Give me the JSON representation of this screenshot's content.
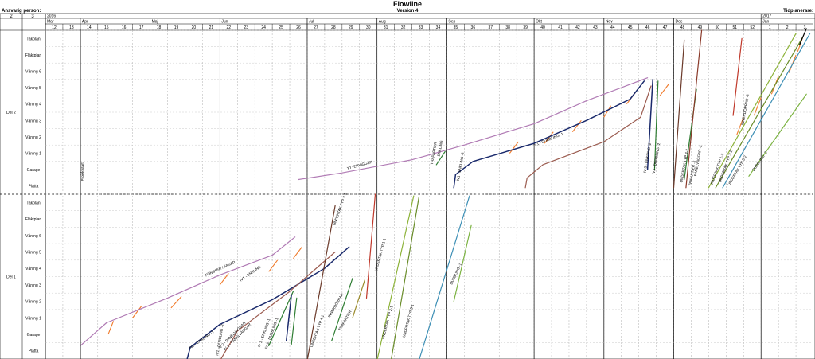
{
  "header": {
    "title": "Flowline",
    "version": "Version 4",
    "responsible_label": "Ansvarig person:",
    "planner_label": "Tidplanerare:",
    "col1_number": "2",
    "col2_number": "3"
  },
  "chart_data": {
    "type": "line",
    "title": "Flowline",
    "subtitle": "Version 4",
    "x_axis": {
      "unit": "week",
      "years": [
        {
          "label": "2016",
          "week": 12
        },
        {
          "label": "2017",
          "week": 53
        }
      ],
      "months": [
        {
          "label": "Mar",
          "week": 12
        },
        {
          "label": "Apr",
          "week": 14
        },
        {
          "label": "Maj",
          "week": 18
        },
        {
          "label": "Jun",
          "week": 22
        },
        {
          "label": "Jul",
          "week": 27
        },
        {
          "label": "Aug",
          "week": 31
        },
        {
          "label": "Sep",
          "week": 35
        },
        {
          "label": "Okt",
          "week": 40
        },
        {
          "label": "Nov",
          "week": 44
        },
        {
          "label": "Dec",
          "week": 48
        },
        {
          "label": "Jan",
          "week": 53
        }
      ],
      "weeks": [
        "12",
        "13",
        "14",
        "15",
        "16",
        "17",
        "18",
        "19",
        "20",
        "21",
        "22",
        "23",
        "24",
        "25",
        "26",
        "27",
        "28",
        "29",
        "30",
        "31",
        "32",
        "33",
        "34",
        "35",
        "36",
        "37",
        "38",
        "39",
        "40",
        "41",
        "42",
        "43",
        "44",
        "45",
        "46",
        "47",
        "48",
        "49",
        "50",
        "51",
        "52",
        "1",
        "2",
        "3"
      ],
      "range": [
        12,
        56
      ]
    },
    "y_axis": {
      "levels": [
        "Platta",
        "Garage",
        "Våning 1",
        "Våning 2",
        "Våning 3",
        "Våning 4",
        "Våning 5",
        "Våning 6",
        "Fläktplan",
        "Takplan"
      ]
    },
    "sections": [
      {
        "name": "Del 2",
        "series": [
          {
            "label": "YTTERVIGGAR",
            "color": "#b07ab4",
            "points": [
              [
                26.5,
                0.4
              ],
              [
                29,
                0.8
              ],
              [
                33,
                1.6
              ],
              [
                36,
                2.5
              ],
              [
                40,
                3.8
              ],
              [
                43,
                5.2
              ],
              [
                46.5,
                6.6
              ]
            ]
          },
          {
            "label": "IV1 - ENKLING -2",
            "color": "#1a2a6c",
            "points": [
              [
                35.4,
                -0.1
              ],
              [
                35.5,
                0.7
              ],
              [
                36.5,
                1.5
              ],
              [
                40,
                2.6
              ],
              [
                43,
                4.0
              ],
              [
                45.5,
                5.3
              ],
              [
                46.3,
                6.4
              ]
            ]
          },
          {
            "label": "IV1 - DUBBLING -1",
            "color": "#9a5a4e",
            "points": [
              [
                39.5,
                -0.1
              ],
              [
                39.6,
                0.5
              ],
              [
                40.5,
                1.3
              ],
              [
                44,
                2.7
              ],
              [
                46.1,
                4.2
              ],
              [
                46.7,
                6.1
              ]
            ]
          },
          {
            "label": "IV3 - ENKLING -2",
            "color": "#1a2a6c",
            "points": [
              [
                46.5,
                1.0
              ],
              [
                46.8,
                6.5
              ]
            ]
          },
          {
            "label": "IV3 - DUBBLING -2",
            "color": "#2e7d32",
            "points": [
              [
                46.9,
                1.0
              ],
              [
                47.1,
                6.4
              ]
            ]
          },
          {
            "label": "TRIPARTIER -2",
            "color": "#6b3a2a",
            "points": [
              [
                48.0,
                -0.1
              ],
              [
                48.6,
                8.9
              ]
            ]
          },
          {
            "label": "PANELVÄGGAR -2",
            "color": "#2e7d32",
            "points": [
              [
                48.6,
                0.4
              ],
              [
                49.3,
                5.9
              ]
            ]
          },
          {
            "label": "UNDERTAK TYP 4-2",
            "color": "#8a3a2a",
            "points": [
              [
                48.7,
                -0.1
              ],
              [
                49.6,
                9.5
              ]
            ]
          },
          {
            "label": "INNERDÖRRAR -2",
            "color": "#c0392b",
            "points": [
              [
                51.4,
                4.3
              ],
              [
                51.9,
                9.0
              ]
            ]
          },
          {
            "label": "UNDERTAK TYP 1-2",
            "color": "#8db33a",
            "points": [
              [
                50.0,
                -0.1
              ],
              [
                55.0,
                9.3
              ]
            ]
          },
          {
            "label": "UNDERTAK TYP 3-2",
            "color": "#6a8d2a",
            "points": [
              [
                50.4,
                -0.1
              ],
              [
                55.4,
                9.1
              ]
            ]
          },
          {
            "label": "UNDERTAK TYP 5-2",
            "color": "#3d8fb5",
            "points": [
              [
                50.8,
                -0.1
              ],
              [
                55.8,
                9.3
              ]
            ]
          },
          {
            "label": "DUBBLING -2",
            "color": "#7cb342",
            "points": [
              [
                52.3,
                0.6
              ],
              [
                55.6,
                5.6
              ]
            ]
          },
          {
            "label": "TRÄPARTIER",
            "color": "#2e7d32",
            "points": [
              [
                34.4,
                1.3
              ],
              [
                34.9,
                2.1
              ]
            ]
          },
          {
            "label": "HISSTRAPP",
            "color": "#000000",
            "points": [
              [
                55.2,
                8.6
              ],
              [
                55.6,
                9.6
              ]
            ]
          }
        ]
      },
      {
        "name": "Del 1",
        "series": [
          {
            "label": "FÖNSTER / FASAD",
            "color": "#b07ab4",
            "points": [
              [
                14.0,
                0.3
              ],
              [
                15.5,
                1.7
              ],
              [
                19,
                3.2
              ],
              [
                22,
                4.6
              ],
              [
                25,
                5.8
              ],
              [
                26.3,
                6.9
              ]
            ]
          },
          {
            "label": "IV1 - ENKLING -1",
            "color": "#1a2a6c",
            "points": [
              [
                20.1,
                -0.6
              ],
              [
                20.3,
                0.2
              ],
              [
                22,
                1.6
              ],
              [
                25,
                3.1
              ],
              [
                28,
                5.0
              ],
              [
                29.4,
                6.3
              ]
            ]
          },
          {
            "label": "IV1 - DUBBLING -2",
            "color": "#9a5a4e",
            "points": [
              [
                22.0,
                -0.6
              ],
              [
                23,
                1.2
              ],
              [
                26,
                3.6
              ],
              [
                28.6,
                6.0
              ]
            ]
          },
          {
            "label": "IV 2 - PANELVÄGGAR",
            "color": "#2e7d32",
            "points": [
              [
                24.8,
                0.3
              ],
              [
                26.2,
                3.6
              ]
            ]
          },
          {
            "label": "IV 3 - ENKLING -1",
            "color": "#1a2a6c",
            "points": [
              [
                25.8,
                0.6
              ],
              [
                26.1,
                3.4
              ]
            ]
          },
          {
            "label": "IV 3 - DUBBLING -1",
            "color": "#2e7d32",
            "points": [
              [
                26.1,
                0.4
              ],
              [
                26.4,
                3.2
              ]
            ]
          },
          {
            "label": "UNDERTAK TYP 4-1",
            "color": "#6b3a2a",
            "points": [
              [
                27.0,
                -0.6
              ],
              [
                28.6,
                8.8
              ]
            ]
          },
          {
            "label": "TRÄPARTIER",
            "color": "#2e7d32",
            "points": [
              [
                28.4,
                0.6
              ],
              [
                29.6,
                4.4
              ]
            ]
          },
          {
            "label": "INNERDÖRRAR",
            "color": "#9a8a2a",
            "points": [
              [
                29.6,
                2.0
              ],
              [
                30.3,
                4.3
              ]
            ]
          },
          {
            "label": "UNDERTAK TYP 1-1",
            "color": "#8db33a",
            "points": [
              [
                31.0,
                -0.6
              ],
              [
                33.1,
                9.4
              ]
            ]
          },
          {
            "label": "UNDERTAK TYP 2-1",
            "color": "#6a8d2a",
            "points": [
              [
                31.8,
                -0.6
              ],
              [
                33.4,
                9.3
              ]
            ]
          },
          {
            "label": "UNDERTAK TYP 5-1",
            "color": "#3d8fb5",
            "points": [
              [
                33.4,
                -0.6
              ],
              [
                36.3,
                9.4
              ]
            ]
          },
          {
            "label": "UNDERTAK TYP 3-1",
            "color": "#c0392b",
            "points": [
              [
                30.4,
                3.2
              ],
              [
                30.9,
                9.5
              ]
            ]
          },
          {
            "label": "DUBBLING -1",
            "color": "#7cb342",
            "points": [
              [
                35.4,
                3.0
              ],
              [
                36.4,
                7.6
              ]
            ]
          },
          {
            "label": "Projektstart",
            "color": "#000000",
            "points": [
              [
                14.0,
                -0.6
              ],
              [
                14.0,
                19.5
              ]
            ]
          }
        ]
      }
    ],
    "annotations": {
      "del2": [
        "YTTERVIGGAR",
        "TRÄPARTIER",
        "ENKLING",
        "IV1 - ENKLING -2",
        "IV1 - DUBBLING -1",
        "IV 3 - ENKLING -2",
        "IV3 - DUBBLING -2",
        "UNDERTAK TYP 4-2",
        "TRIPARTIER -2",
        "PANELVÄGGAR -2",
        "INNERDÖRRAR -2",
        "UNDERTAK TYP 1-2",
        "UNDERTAK TYP 3-2",
        "UNDERTAK TYP 5-2",
        "DUBBLING -2"
      ],
      "del1": [
        "FÖNSTER / FASAD",
        "IV1 - ENKLING -1",
        "IV1 - ENKLING",
        "IV1 - DUBBLING -2",
        "IV 2 - PANELVÄGGAR",
        "IV 2 - PANELVÄGGAR",
        "IV 3 - ENKLING -1",
        "IV 3 - DUBBLING -1",
        "UNDERTAK TYP 4-1",
        "TRÄPARTIER",
        "INNERDÖRRAR",
        "UNDERTAK TYP 1-1",
        "UNDERTAK TYP 2-1",
        "UNDERTAK TYP 5-1",
        "UNDERTAK TYP 3-1",
        "DUBBLING -1"
      ],
      "projektstart": "Projektstart"
    }
  }
}
